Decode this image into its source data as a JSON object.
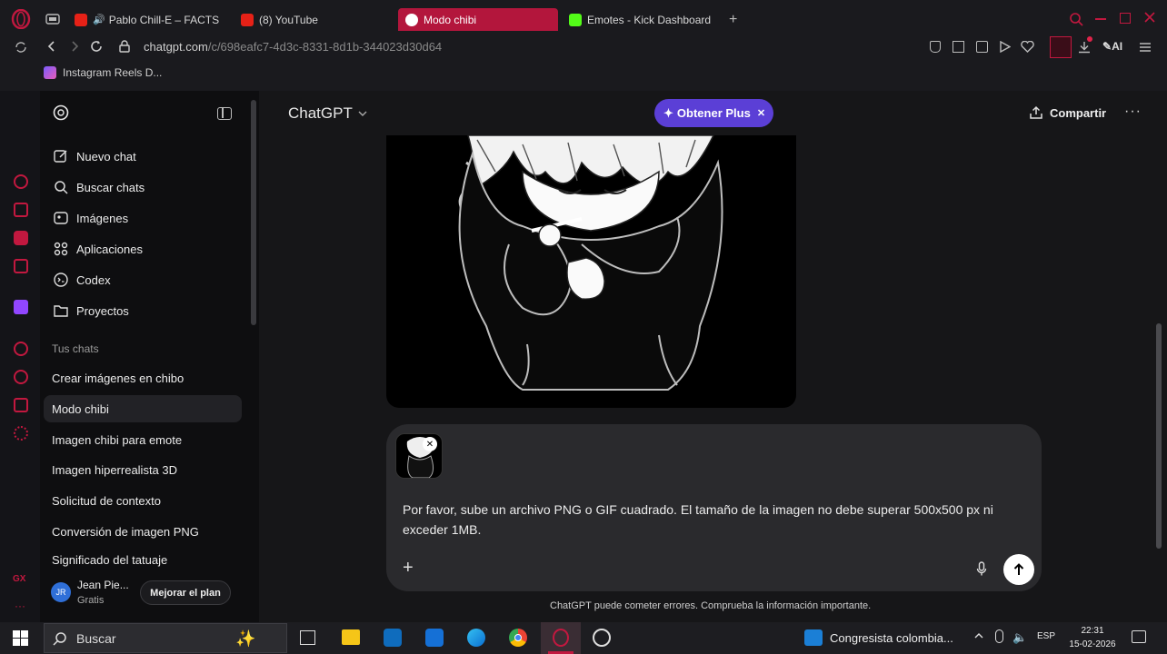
{
  "browser": {
    "tabs": [
      {
        "label": "Pablo Chill-E – FACTS",
        "active": false
      },
      {
        "label": "(8) YouTube",
        "active": false
      },
      {
        "label": "Modo chibi",
        "active": true
      },
      {
        "label": "Emotes - Kick Dashboard",
        "active": false
      }
    ],
    "url_host": "chatgpt.com",
    "url_path": "/c/698eafc7-4d3c-8331-8d1b-344023d30d64",
    "bookmark": "Instagram Reels D...",
    "ai_label": "AI"
  },
  "sidebar": {
    "nav": [
      {
        "label": "Nuevo chat",
        "icon": "edit-icon"
      },
      {
        "label": "Buscar chats",
        "icon": "search-icon"
      },
      {
        "label": "Imágenes",
        "icon": "images-icon"
      },
      {
        "label": "Aplicaciones",
        "icon": "apps-icon"
      },
      {
        "label": "Codex",
        "icon": "codex-icon"
      },
      {
        "label": "Proyectos",
        "icon": "folder-icon"
      }
    ],
    "section_title": "Tus chats",
    "chats": [
      "Crear imágenes en chibo",
      "Modo chibi",
      "Imagen chibi para emote",
      "Imagen hiperrealista 3D",
      "Solicitud de contexto",
      "Conversión de imagen PNG",
      "Significado del tatuaje"
    ],
    "active_chat": "Modo chibi",
    "user": {
      "initials": "JR",
      "name": "Jean Pie...",
      "plan": "Gratis"
    },
    "upgrade_label": "Mejorar el plan"
  },
  "header": {
    "title": "ChatGPT",
    "plus_label": "Obtener Plus",
    "share_label": "Compartir"
  },
  "composer": {
    "text": "Por favor, sube un archivo PNG o GIF cuadrado. El tamaño de la imagen no debe superar 500x500 px ni exceder 1MB.",
    "disclaimer": "ChatGPT puede cometer errores. Comprueba la información importante."
  },
  "taskbar": {
    "search_placeholder": "Buscar",
    "notification": "Congresista colombia...",
    "lang": "ESP",
    "time": "22:31",
    "date": "15-02-2026"
  },
  "colors": {
    "accent_red": "#c2183f",
    "plus_purple": "#5b3fd6",
    "sidebar_bg": "#0e0e10",
    "main_bg": "#161618"
  }
}
